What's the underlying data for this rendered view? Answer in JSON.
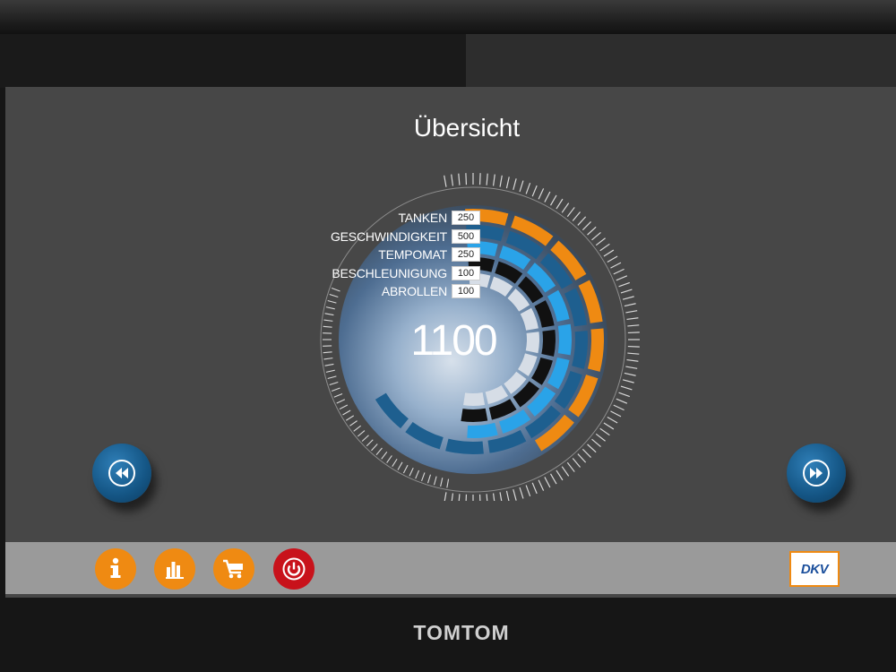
{
  "screen": {
    "title": "Übersicht"
  },
  "legend": [
    {
      "label": "TANKEN",
      "value": "250",
      "color": "#ef8a12"
    },
    {
      "label": "GESCHWINDIGKEIT",
      "value": "500",
      "color": "#1e5f8f"
    },
    {
      "label": "TEMPOMAT",
      "value": "250",
      "color": "#2aa3e8"
    },
    {
      "label": "BESCHLEUNIGUNG",
      "value": "100",
      "color": "#111111"
    },
    {
      "label": "ABROLLEN",
      "value": "100",
      "color": "#d6dde6"
    }
  ],
  "total": {
    "value": "1100"
  },
  "navigation": {
    "prev_icon": "rewind-icon",
    "next_icon": "fast-forward-icon"
  },
  "toolbar": {
    "buttons": [
      {
        "icon": "info-icon",
        "color": "#ef8a12"
      },
      {
        "icon": "bar-chart-icon",
        "color": "#ef8a12"
      },
      {
        "icon": "cart-icon",
        "color": "#ef8a12"
      },
      {
        "icon": "power-icon",
        "color": "#c8121b"
      }
    ],
    "logo": "DKV"
  },
  "device": {
    "brand": "TOMTOM"
  }
}
